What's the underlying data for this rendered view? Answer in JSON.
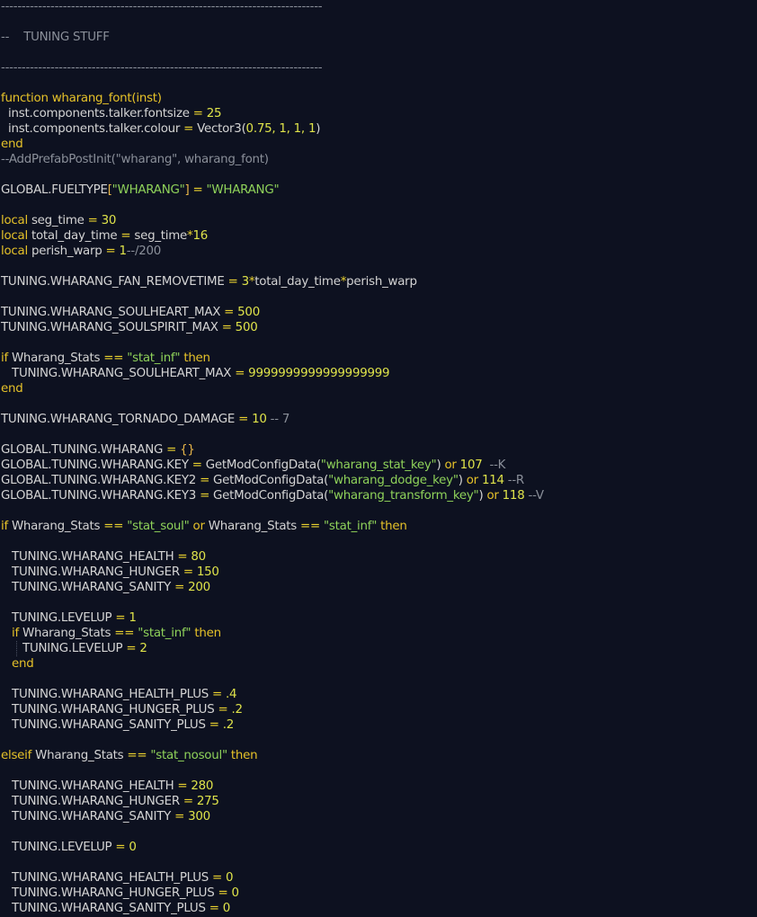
{
  "editor": {
    "lines": [
      {
        "n": 1,
        "tokens": [
          {
            "t": "------------------------------------------------------------------------------",
            "c": "com"
          }
        ]
      },
      {
        "n": 3,
        "tokens": [
          {
            "t": "--    TUNING STUFF",
            "c": "com"
          }
        ]
      },
      {
        "n": 5,
        "tokens": [
          {
            "t": "------------------------------------------------------------------------------",
            "c": "com"
          }
        ]
      },
      {
        "n": 7,
        "tokens": [
          {
            "t": "function",
            "c": "kw"
          },
          {
            "t": " wharang_font(inst)",
            "c": "kw"
          }
        ]
      },
      {
        "n": 8,
        "tokens": [
          {
            "t": "  inst.components.talker.fontsize ",
            "c": "id"
          },
          {
            "t": "=",
            "c": "op"
          },
          {
            "t": " 25",
            "c": "num"
          }
        ]
      },
      {
        "n": 9,
        "tokens": [
          {
            "t": "  inst.components.talker.colour ",
            "c": "id"
          },
          {
            "t": "=",
            "c": "op"
          },
          {
            "t": " Vector3(",
            "c": "id"
          },
          {
            "t": "0.75, 1, 1, 1",
            "c": "num"
          },
          {
            "t": ")",
            "c": "id"
          }
        ]
      },
      {
        "n": 10,
        "tokens": [
          {
            "t": "end",
            "c": "kw"
          }
        ]
      },
      {
        "n": 11,
        "tokens": [
          {
            "t": "--AddPrefabPostInit(\"wharang\", wharang_font)",
            "c": "com"
          }
        ]
      },
      {
        "n": 13,
        "tokens": [
          {
            "t": "GLOBAL.FUELTYPE",
            "c": "id"
          },
          {
            "t": "[",
            "c": "brk"
          },
          {
            "t": "\"WHARANG\"",
            "c": "str"
          },
          {
            "t": "]",
            "c": "brk"
          },
          {
            "t": " = ",
            "c": "op"
          },
          {
            "t": "\"WHARANG\"",
            "c": "str"
          }
        ]
      },
      {
        "n": 15,
        "tokens": [
          {
            "t": "local",
            "c": "kw"
          },
          {
            "t": " seg_time ",
            "c": "id"
          },
          {
            "t": "=",
            "c": "op"
          },
          {
            "t": " 30",
            "c": "num"
          }
        ]
      },
      {
        "n": 16,
        "tokens": [
          {
            "t": "local",
            "c": "kw"
          },
          {
            "t": " total_day_time ",
            "c": "id"
          },
          {
            "t": "=",
            "c": "op"
          },
          {
            "t": " seg_time",
            "c": "id"
          },
          {
            "t": "*",
            "c": "op"
          },
          {
            "t": "16",
            "c": "num"
          }
        ]
      },
      {
        "n": 17,
        "tokens": [
          {
            "t": "local",
            "c": "kw"
          },
          {
            "t": " perish_warp ",
            "c": "id"
          },
          {
            "t": "=",
            "c": "op"
          },
          {
            "t": " 1",
            "c": "num"
          },
          {
            "t": "--/200",
            "c": "com"
          }
        ]
      },
      {
        "n": 19,
        "tokens": [
          {
            "t": "TUNING.WHARANG_FAN_REMOVETIME ",
            "c": "id"
          },
          {
            "t": "=",
            "c": "op"
          },
          {
            "t": " 3",
            "c": "num"
          },
          {
            "t": "*",
            "c": "op"
          },
          {
            "t": "total_day_time",
            "c": "id"
          },
          {
            "t": "*",
            "c": "op"
          },
          {
            "t": "perish_warp",
            "c": "id"
          }
        ]
      },
      {
        "n": 21,
        "tokens": [
          {
            "t": "TUNING.WHARANG_SOULHEART_MAX ",
            "c": "id"
          },
          {
            "t": "=",
            "c": "op"
          },
          {
            "t": " 500",
            "c": "num"
          }
        ]
      },
      {
        "n": 22,
        "tokens": [
          {
            "t": "TUNING.WHARANG_SOULSPIRIT_MAX ",
            "c": "id"
          },
          {
            "t": "=",
            "c": "op"
          },
          {
            "t": " 500",
            "c": "num"
          }
        ]
      },
      {
        "n": 24,
        "tokens": [
          {
            "t": "if",
            "c": "kw"
          },
          {
            "t": " Wharang_Stats ",
            "c": "id"
          },
          {
            "t": "==",
            "c": "op"
          },
          {
            "t": " ",
            "c": "id"
          },
          {
            "t": "\"stat_inf\"",
            "c": "str"
          },
          {
            "t": " then",
            "c": "kw"
          }
        ]
      },
      {
        "n": 25,
        "tokens": [
          {
            "t": "   TUNING.WHARANG_SOULHEART_MAX ",
            "c": "id"
          },
          {
            "t": "=",
            "c": "op"
          },
          {
            "t": " 9999999999999999999",
            "c": "num"
          }
        ]
      },
      {
        "n": 26,
        "tokens": [
          {
            "t": "end",
            "c": "kw"
          }
        ]
      },
      {
        "n": 28,
        "tokens": [
          {
            "t": "TUNING.WHARANG_TORNADO_DAMAGE ",
            "c": "id"
          },
          {
            "t": "=",
            "c": "op"
          },
          {
            "t": " 10",
            "c": "num"
          },
          {
            "t": " -- 7",
            "c": "com"
          }
        ]
      },
      {
        "n": 30,
        "tokens": [
          {
            "t": "GLOBAL.TUNING.WHARANG ",
            "c": "id"
          },
          {
            "t": "=",
            "c": "op"
          },
          {
            "t": " {}",
            "c": "brk"
          }
        ]
      },
      {
        "n": 31,
        "tokens": [
          {
            "t": "GLOBAL.TUNING.WHARANG.KEY ",
            "c": "id"
          },
          {
            "t": "=",
            "c": "op"
          },
          {
            "t": " GetModConfigData(",
            "c": "id"
          },
          {
            "t": "\"wharang_stat_key\"",
            "c": "str"
          },
          {
            "t": ") ",
            "c": "id"
          },
          {
            "t": "or",
            "c": "kw"
          },
          {
            "t": " 107",
            "c": "num"
          },
          {
            "t": "  --K",
            "c": "com"
          }
        ]
      },
      {
        "n": 32,
        "tokens": [
          {
            "t": "GLOBAL.TUNING.WHARANG.KEY2 ",
            "c": "id"
          },
          {
            "t": "=",
            "c": "op"
          },
          {
            "t": " GetModConfigData(",
            "c": "id"
          },
          {
            "t": "\"wharang_dodge_key\"",
            "c": "str"
          },
          {
            "t": ") ",
            "c": "id"
          },
          {
            "t": "or",
            "c": "kw"
          },
          {
            "t": " 114",
            "c": "num"
          },
          {
            "t": " --R",
            "c": "com"
          }
        ]
      },
      {
        "n": 33,
        "tokens": [
          {
            "t": "GLOBAL.TUNING.WHARANG.KEY3 ",
            "c": "id"
          },
          {
            "t": "=",
            "c": "op"
          },
          {
            "t": " GetModConfigData(",
            "c": "id"
          },
          {
            "t": "\"wharang_transform_key\"",
            "c": "str"
          },
          {
            "t": ") ",
            "c": "id"
          },
          {
            "t": "or",
            "c": "kw"
          },
          {
            "t": " 118",
            "c": "num"
          },
          {
            "t": " --V",
            "c": "com"
          }
        ]
      },
      {
        "n": 35,
        "tokens": [
          {
            "t": "if",
            "c": "kw"
          },
          {
            "t": " Wharang_Stats ",
            "c": "id"
          },
          {
            "t": "==",
            "c": "op"
          },
          {
            "t": " ",
            "c": "id"
          },
          {
            "t": "\"stat_soul\"",
            "c": "str"
          },
          {
            "t": " or",
            "c": "kw"
          },
          {
            "t": " Wharang_Stats ",
            "c": "id"
          },
          {
            "t": "==",
            "c": "op"
          },
          {
            "t": " ",
            "c": "id"
          },
          {
            "t": "\"stat_inf\"",
            "c": "str"
          },
          {
            "t": " then",
            "c": "kw"
          }
        ]
      },
      {
        "n": 37,
        "tokens": [
          {
            "t": "   TUNING.WHARANG_HEALTH ",
            "c": "id"
          },
          {
            "t": "=",
            "c": "op"
          },
          {
            "t": " 80",
            "c": "num"
          }
        ]
      },
      {
        "n": 38,
        "tokens": [
          {
            "t": "   TUNING.WHARANG_HUNGER ",
            "c": "id"
          },
          {
            "t": "=",
            "c": "op"
          },
          {
            "t": " 150",
            "c": "num"
          }
        ]
      },
      {
        "n": 39,
        "tokens": [
          {
            "t": "   TUNING.WHARANG_SANITY ",
            "c": "id"
          },
          {
            "t": "=",
            "c": "op"
          },
          {
            "t": " 200",
            "c": "num"
          }
        ]
      },
      {
        "n": 41,
        "tokens": [
          {
            "t": "   TUNING.LEVELUP ",
            "c": "id"
          },
          {
            "t": "=",
            "c": "op"
          },
          {
            "t": " 1",
            "c": "num"
          }
        ]
      },
      {
        "n": 42,
        "tokens": [
          {
            "t": "   if",
            "c": "kw"
          },
          {
            "t": " Wharang_Stats ",
            "c": "id"
          },
          {
            "t": "==",
            "c": "op"
          },
          {
            "t": " ",
            "c": "id"
          },
          {
            "t": "\"stat_inf\"",
            "c": "str"
          },
          {
            "t": " then",
            "c": "kw"
          }
        ]
      },
      {
        "n": 43,
        "tokens": [
          {
            "t": "      TUNING.LEVELUP ",
            "c": "id"
          },
          {
            "t": "=",
            "c": "op"
          },
          {
            "t": " 2",
            "c": "num"
          }
        ]
      },
      {
        "n": 44,
        "tokens": [
          {
            "t": "   end",
            "c": "kw"
          }
        ]
      },
      {
        "n": 46,
        "tokens": [
          {
            "t": "   TUNING.WHARANG_HEALTH_PLUS ",
            "c": "id"
          },
          {
            "t": "=",
            "c": "op"
          },
          {
            "t": " .4",
            "c": "num"
          }
        ]
      },
      {
        "n": 47,
        "tokens": [
          {
            "t": "   TUNING.WHARANG_HUNGER_PLUS ",
            "c": "id"
          },
          {
            "t": "=",
            "c": "op"
          },
          {
            "t": " .2",
            "c": "num"
          }
        ]
      },
      {
        "n": 48,
        "tokens": [
          {
            "t": "   TUNING.WHARANG_SANITY_PLUS ",
            "c": "id"
          },
          {
            "t": "=",
            "c": "op"
          },
          {
            "t": " .2",
            "c": "num"
          }
        ]
      },
      {
        "n": 50,
        "tokens": [
          {
            "t": "elseif",
            "c": "kw"
          },
          {
            "t": " Wharang_Stats ",
            "c": "id"
          },
          {
            "t": "==",
            "c": "op"
          },
          {
            "t": " ",
            "c": "id"
          },
          {
            "t": "\"stat_nosoul\"",
            "c": "str"
          },
          {
            "t": " then",
            "c": "kw"
          }
        ]
      },
      {
        "n": 52,
        "tokens": [
          {
            "t": "   TUNING.WHARANG_HEALTH ",
            "c": "id"
          },
          {
            "t": "=",
            "c": "op"
          },
          {
            "t": " 280",
            "c": "num"
          }
        ]
      },
      {
        "n": 53,
        "tokens": [
          {
            "t": "   TUNING.WHARANG_HUNGER ",
            "c": "id"
          },
          {
            "t": "=",
            "c": "op"
          },
          {
            "t": " 275",
            "c": "num"
          }
        ]
      },
      {
        "n": 54,
        "tokens": [
          {
            "t": "   TUNING.WHARANG_SANITY ",
            "c": "id"
          },
          {
            "t": "=",
            "c": "op"
          },
          {
            "t": " 300",
            "c": "num"
          }
        ]
      },
      {
        "n": 56,
        "tokens": [
          {
            "t": "   TUNING.LEVELUP ",
            "c": "id"
          },
          {
            "t": "=",
            "c": "op"
          },
          {
            "t": " 0",
            "c": "num"
          }
        ]
      },
      {
        "n": 58,
        "tokens": [
          {
            "t": "   TUNING.WHARANG_HEALTH_PLUS ",
            "c": "id"
          },
          {
            "t": "=",
            "c": "op"
          },
          {
            "t": " 0",
            "c": "num"
          }
        ]
      },
      {
        "n": 59,
        "tokens": [
          {
            "t": "   TUNING.WHARANG_HUNGER_PLUS ",
            "c": "id"
          },
          {
            "t": "=",
            "c": "op"
          },
          {
            "t": " 0",
            "c": "num"
          }
        ]
      },
      {
        "n": 60,
        "tokens": [
          {
            "t": "   TUNING.WHARANG_SANITY_PLUS ",
            "c": "id"
          },
          {
            "t": "=",
            "c": "op"
          },
          {
            "t": " 0",
            "c": "num"
          }
        ]
      }
    ]
  }
}
